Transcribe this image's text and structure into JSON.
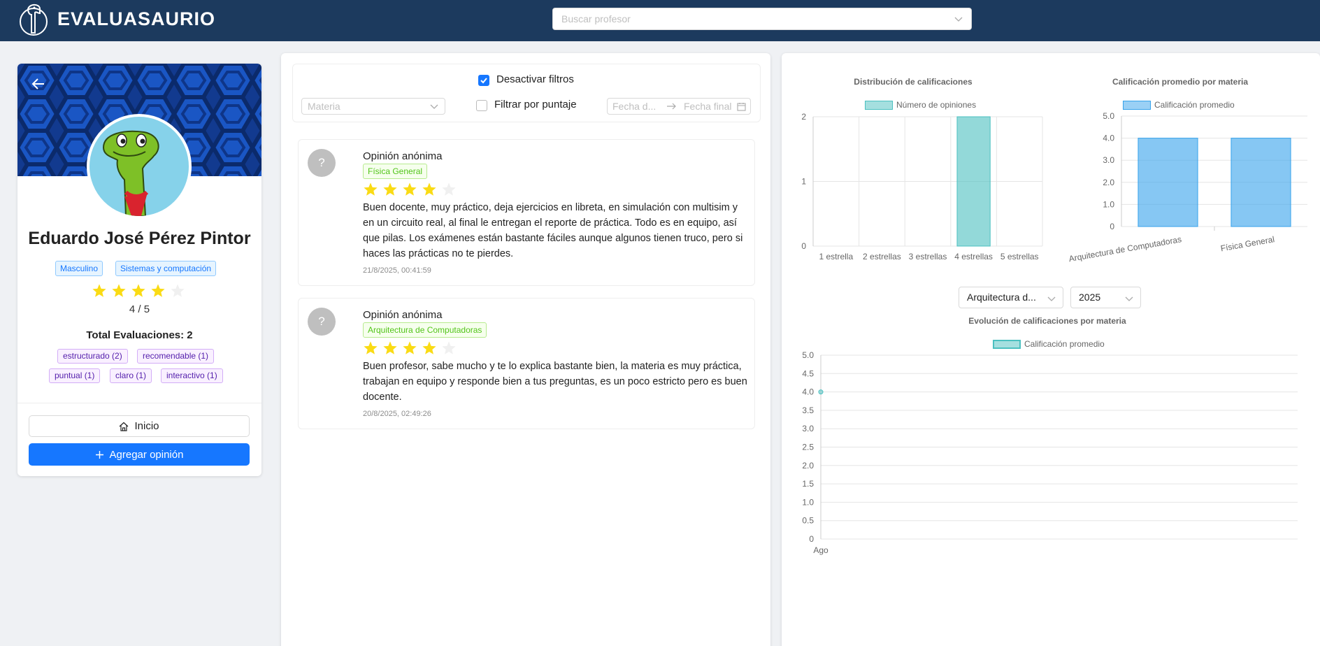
{
  "app": {
    "name": "EVALUASAURIO",
    "search_placeholder": "Buscar profesor"
  },
  "profile": {
    "name": "Eduardo José Pérez Pintor",
    "gender": "Masculino",
    "department": "Sistemas y computación",
    "rating": 4,
    "max_rating": 5,
    "score_text": "4 / 5",
    "total_label": "Total Evaluaciones: 2",
    "tags": [
      "estructurado (2)",
      "recomendable (1)",
      "puntual (1)",
      "claro (1)",
      "interactivo (1)"
    ],
    "home_button": "Inicio",
    "add_button": "Agregar opinión"
  },
  "filters": {
    "disable_label": "Desactivar filtros",
    "disable_checked": true,
    "subject_placeholder": "Materia",
    "score_filter_label": "Filtrar por puntaje",
    "score_filter_checked": false,
    "date_start_placeholder": "Fecha d...",
    "date_end_placeholder": "Fecha final"
  },
  "opinions": [
    {
      "author": "Opinión anónima",
      "avatar": "?",
      "subject": "Física General",
      "rating": 4,
      "text": "Buen docente, muy práctico, deja ejercicios en libreta, en simulación con multisim y en un circuito real, al final le entregan el reporte de práctica. Todo es en equipo, así que pilas. Los exámenes están bastante fáciles aunque algunos tienen truco, pero si haces las prácticas no te pierdes.",
      "date": "21/8/2025, 00:41:59"
    },
    {
      "author": "Opinión anónima",
      "avatar": "?",
      "subject": "Arquitectura de Computadoras",
      "rating": 4,
      "text": "Buen profesor, sabe mucho y te lo explica bastante bien, la materia es muy práctica, trabajan en equipo y responde bien a tus preguntas, es un poco estricto pero es buen docente.",
      "date": "20/8/2025, 02:49:26"
    }
  ],
  "dropdowns": {
    "subject_selected": "Arquitectura d...",
    "year_selected": "2025"
  },
  "colors": {
    "topbar": "#1c3a5e",
    "primary": "#1677ff",
    "star": "#fadb14",
    "teal": "#4bc0c0",
    "blue": "#36a2eb"
  },
  "chart_data": [
    {
      "type": "bar",
      "title": "Distribución de calificaciones",
      "categories": [
        "1 estrella",
        "2 estrellas",
        "3 estrellas",
        "4 estrellas",
        "5 estrellas"
      ],
      "series": [
        {
          "name": "Número de opiniones",
          "values": [
            0,
            0,
            0,
            2,
            0
          ]
        }
      ],
      "ylim": [
        0,
        2
      ],
      "yticks": [
        "0",
        "1",
        "2"
      ],
      "legend": "top"
    },
    {
      "type": "bar",
      "title": "Calificación promedio por materia",
      "categories": [
        "Arquitectura de Computadoras",
        "Física General"
      ],
      "series": [
        {
          "name": "Calificación promedio",
          "values": [
            4,
            4
          ]
        }
      ],
      "ylim": [
        0,
        5
      ],
      "yticks": [
        "0",
        "1.0",
        "2.0",
        "3.0",
        "4.0",
        "5.0"
      ],
      "legend": "top"
    },
    {
      "type": "line",
      "title": "Evolución de calificaciones por materia",
      "x": [
        "Ago"
      ],
      "series": [
        {
          "name": "Calificación promedio",
          "values": [
            4
          ]
        }
      ],
      "ylim": [
        0,
        5
      ],
      "yticks": [
        "0",
        "0.5",
        "1.0",
        "1.5",
        "2.0",
        "2.5",
        "3.0",
        "3.5",
        "4.0",
        "4.5",
        "5.0"
      ],
      "legend": "top"
    }
  ]
}
